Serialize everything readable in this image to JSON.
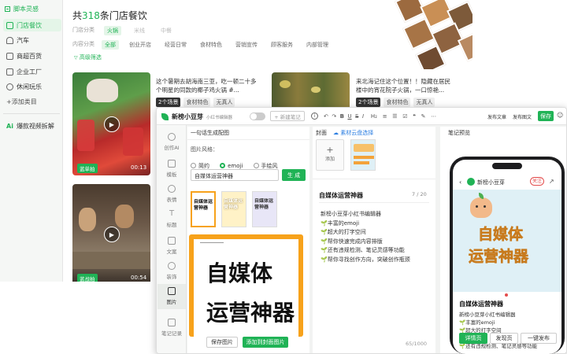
{
  "sidebar": {
    "section_title": "脚本灵感",
    "items": [
      {
        "label": "门店餐饮",
        "active": true
      },
      {
        "label": "汽车"
      },
      {
        "label": "商超百货"
      },
      {
        "label": "企业工厂"
      },
      {
        "label": "休闲玩乐"
      }
    ],
    "add_label": "+添加类目",
    "ai_label": "爆款视频拆解"
  },
  "browse": {
    "title_prefix": "共",
    "count": "318",
    "title_suffix": "条门店餐饮",
    "filters": {
      "row1_label": "门店分类",
      "row1_chips": [
        "火锅",
        "米线",
        "中餐"
      ],
      "row2_label": "内容分类",
      "row2_chips": [
        "全部",
        "创业开店",
        "经营日常",
        "食材特色",
        "营销宣传",
        "顾客服务",
        "内部管理"
      ],
      "advanced": "高级筛选"
    },
    "cards": [
      {
        "text": "这个暑期去胡海南三亚，吃一顿二十多个明星的同款的椰子鸡火锅 #...",
        "tags": [
          "2个场景",
          "食材特色",
          "无真人"
        ],
        "badge": "蓝单拍",
        "duration": "00:13"
      },
      {
        "text": "来北海记住这个位置！！隐藏在居民楼中的宵花院子火锅，一口惊艳...",
        "tags": [
          "2个场景",
          "食材特色",
          "无真人"
        ]
      },
      {
        "badge": "蓝战拍",
        "duration": "00:54"
      }
    ]
  },
  "editor": {
    "app_name": "新榜小豆芽",
    "app_subtitle": "小红书编辑器",
    "new_note": "+ 新建笔记",
    "toolbar": {
      "heading": "H₂",
      "publish_article": "发布文章",
      "publish_image": "发布图文",
      "save": "保存"
    },
    "tools": [
      {
        "label": "创作AI"
      },
      {
        "label": "模板"
      },
      {
        "label": "表情"
      },
      {
        "label": "标题"
      },
      {
        "label": "文案"
      },
      {
        "label": "装饰"
      },
      {
        "label": "图片",
        "active": true
      },
      {
        "label": "笔记记录"
      }
    ],
    "generator": {
      "header": "一句话生成配图",
      "style_label": "图片风格：",
      "styles": [
        "简约",
        "emoji",
        "手绘风"
      ],
      "selected_style": "emoji",
      "input_value": "自媒体运营神器",
      "generate_btn": "生 成",
      "thumb_text": "自媒体运营神器",
      "preview_line1": "自媒体",
      "preview_line2": "运营神器",
      "save_btn": "保存图片",
      "add_cover_btn": "添加到封面图片"
    },
    "content": {
      "cover_label": "封面",
      "library_link": "☁ 素材云盘选择",
      "add_label": "添加",
      "note_title": "自媒体运营神器",
      "title_count": "7 / 20",
      "lines": [
        "新榜小豆芽小红书编辑器",
        "🌱丰富的emoji",
        "🌱超大的打字空间",
        "🌱帮你快速完成内容排版",
        "🌱还有违规检测、笔记灵感等功能",
        "🌱帮你寻找创作方向，突破创作瓶颈"
      ],
      "char_count": "65/1000"
    },
    "preview": {
      "header": "笔记预览",
      "account": "新榜小豆芽",
      "follow": "关注",
      "cover_line1": "自媒体",
      "cover_line2": "运营神器",
      "note_title": "自媒体运营神器",
      "lines": [
        "新榜小豆芽小红书编辑器",
        "🌱丰富的emoji",
        "🌱超大的打字空间",
        "🌱还有违规检测、笔记灵感等功能"
      ],
      "btn_detail": "详情页",
      "btn_discover": "发现页",
      "btn_publish": "一键发布"
    }
  },
  "colors": {
    "brand": "#20b356",
    "accent_orange": "#f7a21b",
    "cover_bg": "#dff0f6"
  }
}
